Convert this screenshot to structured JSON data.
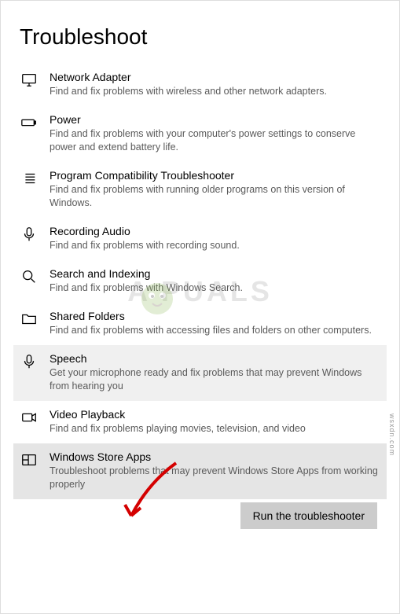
{
  "page": {
    "title": "Troubleshoot"
  },
  "items": [
    {
      "title": "Network Adapter",
      "desc": "Find and fix problems with wireless and other network adapters."
    },
    {
      "title": "Power",
      "desc": "Find and fix problems with your computer's power settings to conserve power and extend battery life."
    },
    {
      "title": "Program Compatibility Troubleshooter",
      "desc": "Find and fix problems with running older programs on this version of Windows."
    },
    {
      "title": "Recording Audio",
      "desc": "Find and fix problems with recording sound."
    },
    {
      "title": "Search and Indexing",
      "desc": "Find and fix problems with Windows Search."
    },
    {
      "title": "Shared Folders",
      "desc": "Find and fix problems with accessing files and folders on other computers."
    },
    {
      "title": "Speech",
      "desc": "Get your microphone ready and fix problems that may prevent Windows from hearing you"
    },
    {
      "title": "Video Playback",
      "desc": "Find and fix problems playing movies, television, and video"
    },
    {
      "title": "Windows Store Apps",
      "desc": "Troubleshoot problems that may prevent Windows Store Apps from working properly"
    }
  ],
  "button": {
    "run": "Run the troubleshooter"
  },
  "watermark": {
    "text": "A    PUALS",
    "credit": "wsxdn.com"
  }
}
